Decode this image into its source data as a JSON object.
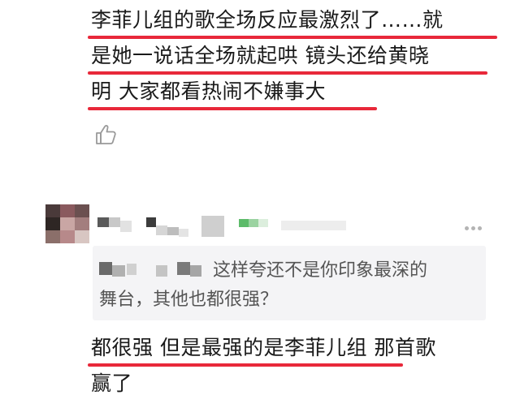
{
  "colors": {
    "underline": "#e8283a",
    "quote_background": "#f4f4f6",
    "quote_text": "#555555",
    "icon_gray": "#b4b4b4"
  },
  "first_comment": {
    "lines": [
      "李菲儿组的歌全场反应最激烈了……就",
      "是她一说话全场就起哄 镜头还给黄晓",
      "明 大家都看热闹不嫌事大"
    ],
    "like_icon": "thumbs-up-icon"
  },
  "reply": {
    "more_icon": "more-options-icon",
    "quoted": {
      "line1": "这样夸还不是你印象最深的",
      "line2": "舞台，其他也都很强？"
    },
    "lines": [
      "都很强 但是最强的是李菲儿组 那首歌",
      "赢了"
    ]
  }
}
